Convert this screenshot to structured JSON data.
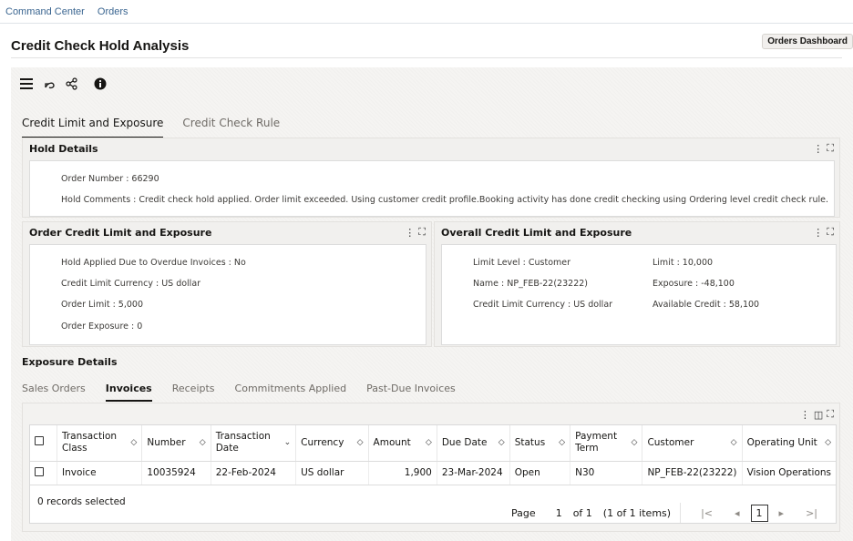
{
  "breadcrumb": [
    "Command Center",
    "Orders"
  ],
  "header": {
    "title": "Credit Check Hold Analysis",
    "dashboard_button": "Orders Dashboard"
  },
  "toolbar": {
    "icons": [
      "menu-icon",
      "undo-icon",
      "share-icon",
      "info-icon"
    ]
  },
  "main_tabs": [
    {
      "label": "Credit Limit and Exposure",
      "active": true
    },
    {
      "label": "Credit Check Rule",
      "active": false
    }
  ],
  "hold_details": {
    "title": "Hold Details",
    "order_number": "Order Number : 66290",
    "hold_comments": "Hold Comments : Credit check hold applied. Order limit exceeded. Using customer credit profile.Booking activity has done credit checking using Ordering level credit check rule."
  },
  "order_credit": {
    "title": "Order Credit Limit and Exposure",
    "fields": [
      "Hold Applied Due to Overdue Invoices : No",
      "Credit Limit Currency : US dollar",
      "Order Limit : 5,000",
      "Order Exposure : 0"
    ]
  },
  "overall_credit": {
    "title": "Overall Credit Limit and Exposure",
    "left_fields": [
      "Limit Level : Customer",
      "Name : NP_FEB-22(23222)",
      "Credit Limit Currency : US dollar"
    ],
    "right_fields": [
      "Limit : 10,000",
      "Exposure : -48,100",
      "Available Credit : 58,100"
    ]
  },
  "exposure": {
    "title": "Exposure Details",
    "tabs": [
      {
        "label": "Sales Orders",
        "active": false
      },
      {
        "label": "Invoices",
        "active": true
      },
      {
        "label": "Receipts",
        "active": false
      },
      {
        "label": "Commitments Applied",
        "active": false
      },
      {
        "label": "Past-Due Invoices",
        "active": false
      }
    ],
    "columns": [
      "Transaction Class",
      "Number",
      "Transaction Date",
      "Currency",
      "Amount",
      "Due Date",
      "Status",
      "Payment Term",
      "Customer",
      "Operating Unit"
    ],
    "rows": [
      [
        "Invoice",
        "10035924",
        "22-Feb-2024",
        "US dollar",
        "1,900",
        "23-Mar-2024",
        "Open",
        "N30",
        "NP_FEB-22(23222)",
        "Vision Operations"
      ]
    ],
    "selected_text": "0 records selected",
    "pager": {
      "page_label": "Page",
      "page": "1",
      "of": "of 1",
      "items": "(1 of 1 items)",
      "current": "1"
    }
  }
}
